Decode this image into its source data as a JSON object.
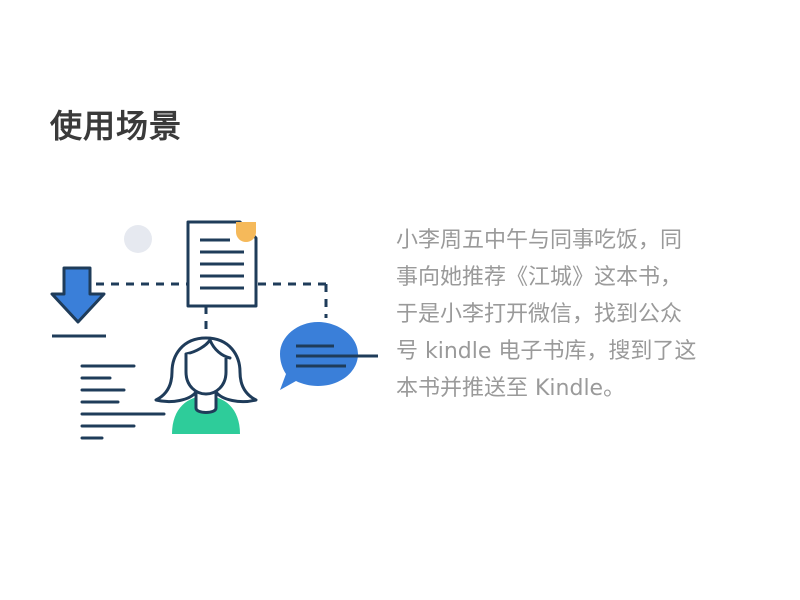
{
  "page": {
    "title": "使用场景"
  },
  "description": {
    "lines": [
      "小李周五中午与同事吃饭，同",
      "事向她推荐《江城》这本书，",
      "于是小李打开微信，找到公众",
      "号 kindle 电子书库，搜到了这",
      "本书并推送至 Kindle。"
    ]
  },
  "colors": {
    "title": "#3a3a3a",
    "text": "#9a9a9a",
    "navy": "#1f3c5a",
    "blue": "#3a7fd9",
    "green": "#2ecc9a",
    "yellow": "#f5b95a",
    "dot": "#e6e9f0"
  },
  "icons": [
    "download-arrow-icon",
    "document-icon",
    "person-icon",
    "chat-bubble-icon"
  ]
}
